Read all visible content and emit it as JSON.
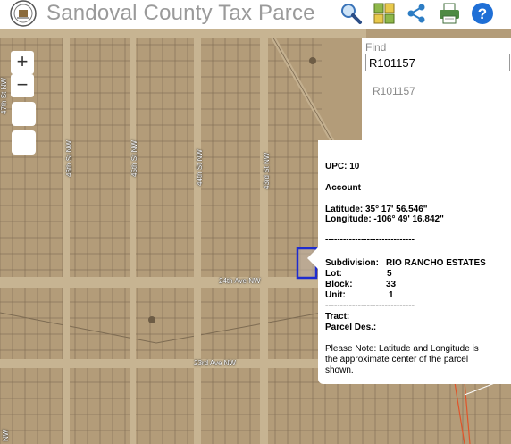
{
  "header": {
    "title": "Sandoval County Tax Parce"
  },
  "toolbar": {
    "icons": [
      "search-icon",
      "grid-icon",
      "share-icon",
      "print-icon",
      "help-icon"
    ]
  },
  "map": {
    "zoom_in": "+",
    "zoom_out": "−",
    "streets": {
      "s47": "47th St NW",
      "s46": "46th St NW",
      "s45": "45th St NW",
      "s44": "44th St NW",
      "s43": "43rd St NW",
      "ave24": "24th Ave NW",
      "ave23": "23rd Ave NW",
      "left_bottom": "NW"
    }
  },
  "find": {
    "label": "Find",
    "value": "R101157",
    "result": "R101157"
  },
  "popup": {
    "upc": "UPC: 10",
    "account": "Account",
    "latitude": "Latitude: 35° 17' 56.546\"",
    "longitude": "Longitude: -106° 49' 16.842\"",
    "divider": "------------------------------",
    "subdivision_label": "Subdivision:",
    "subdivision_value": "RIO RANCHO ESTATES",
    "lot_label": "Lot:",
    "lot_value": "5",
    "block_label": "Block:",
    "block_value": "33",
    "unit_label": "Unit:",
    "unit_value": "1",
    "divider2": "------------------------------",
    "tract_label": "Tract:",
    "parcel_label": "Parcel Des.:",
    "note_1": "Please Note: Latitude and Longitude is",
    "note_2": "the approximate center of the parcel",
    "note_3": "shown."
  },
  "colors": {
    "map_bg": "#b19a77",
    "highlight": "#1e2ccf",
    "title_grey": "#9a9a9a"
  }
}
